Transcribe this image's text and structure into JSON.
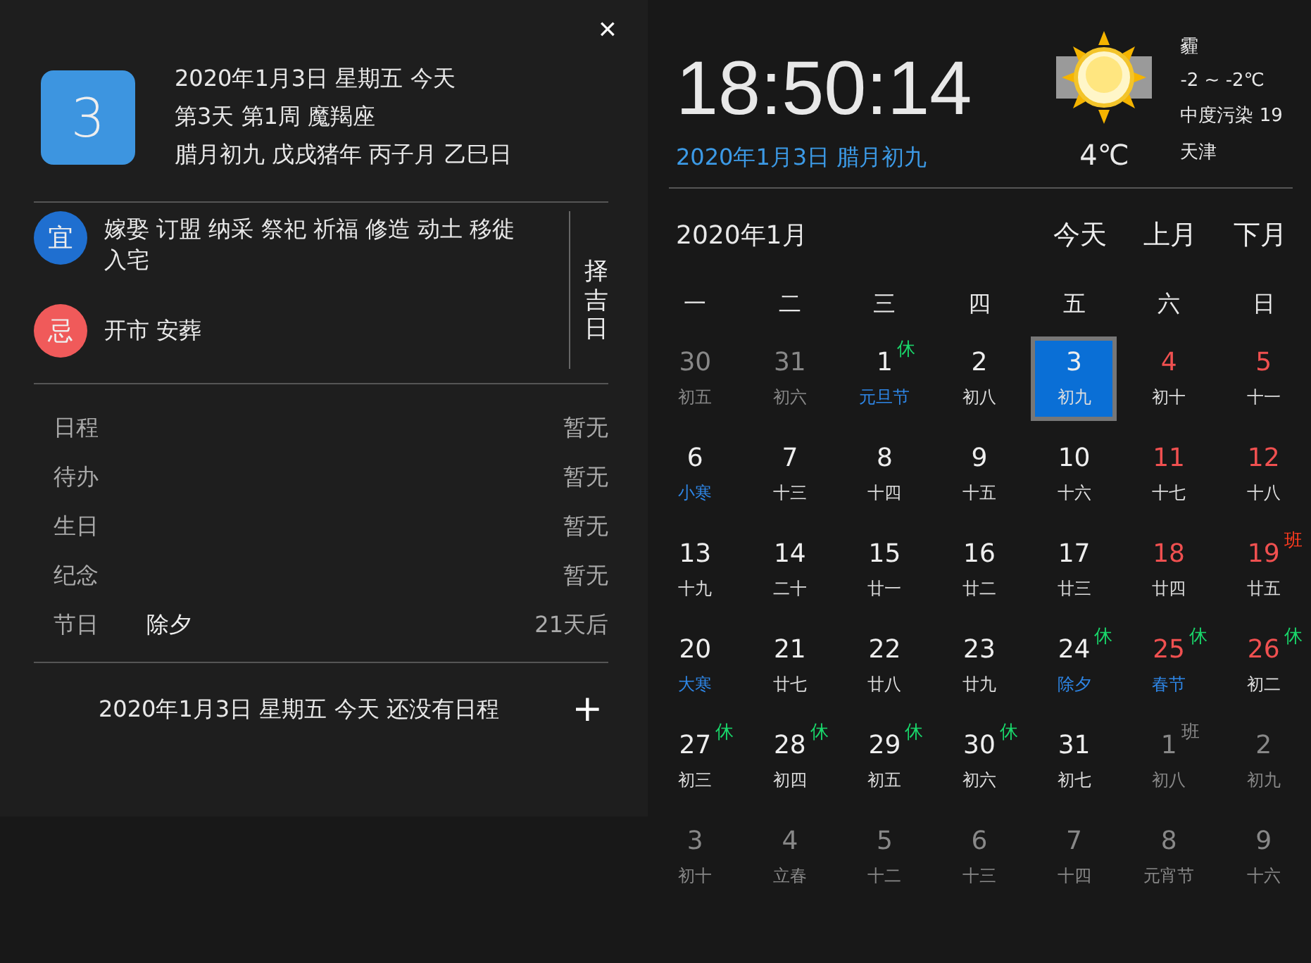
{
  "info": {
    "day": "3",
    "lines": [
      "2020年1月3日 星期五 今天",
      "第3天 第1周 魔羯座",
      "腊月初九 戊戌猪年 丙子月 乙巳日"
    ]
  },
  "close": "×",
  "almanac": [
    {
      "kind": "good",
      "mark": "宜",
      "text": "嫁娶 订盟 纳采 祭祀 祈福 修造 动土 移徙入宅"
    },
    {
      "kind": "bad",
      "mark": "忌",
      "text": "开市 安葬"
    }
  ],
  "pick_day": "择吉日",
  "agenda": [
    {
      "label": "日程",
      "value": "暂无"
    },
    {
      "label": "待办",
      "value": "暂无"
    },
    {
      "label": "生日",
      "value": "暂无"
    },
    {
      "label": "纪念",
      "value": "暂无"
    },
    {
      "label": "节日",
      "detail": "除夕",
      "value": "21天后"
    }
  ],
  "footer": {
    "text": "2020年1月3日 星期五 今天 还没有日程",
    "add": "+"
  },
  "clock": {
    "time": "18:50:14",
    "date": "2020年1月3日 腊月初九"
  },
  "weather": {
    "temp": "4℃",
    "lines": [
      "霾",
      "-2 ~ -2℃",
      "中度污染 19",
      "天津"
    ]
  },
  "calendar": {
    "month": "2020年1月",
    "nav": [
      "今天",
      "上月",
      "下月"
    ],
    "weekdays": [
      "一",
      "二",
      "三",
      "四",
      "五",
      "六",
      "日"
    ],
    "days": [
      {
        "day": "30",
        "lunar": "初五",
        "other_month": true,
        "weekend": false,
        "festival": false,
        "selected": false
      },
      {
        "day": "31",
        "lunar": "初六",
        "other_month": true,
        "weekend": false,
        "festival": false,
        "selected": false
      },
      {
        "day": "1",
        "lunar": "元旦节",
        "other_month": false,
        "weekend": false,
        "festival": true,
        "selected": false,
        "badge": {
          "text": "休",
          "kind": "rest"
        }
      },
      {
        "day": "2",
        "lunar": "初八",
        "other_month": false,
        "weekend": false,
        "festival": false,
        "selected": false
      },
      {
        "day": "3",
        "lunar": "初九",
        "other_month": false,
        "weekend": false,
        "festival": false,
        "selected": true
      },
      {
        "day": "4",
        "lunar": "初十",
        "other_month": false,
        "weekend": true,
        "festival": false,
        "selected": false
      },
      {
        "day": "5",
        "lunar": "十一",
        "other_month": false,
        "weekend": true,
        "festival": false,
        "selected": false
      },
      {
        "day": "6",
        "lunar": "小寒",
        "other_month": false,
        "weekend": false,
        "festival": true,
        "selected": false
      },
      {
        "day": "7",
        "lunar": "十三",
        "other_month": false,
        "weekend": false,
        "festival": false,
        "selected": false
      },
      {
        "day": "8",
        "lunar": "十四",
        "other_month": false,
        "weekend": false,
        "festival": false,
        "selected": false
      },
      {
        "day": "9",
        "lunar": "十五",
        "other_month": false,
        "weekend": false,
        "festival": false,
        "selected": false
      },
      {
        "day": "10",
        "lunar": "十六",
        "other_month": false,
        "weekend": false,
        "festival": false,
        "selected": false
      },
      {
        "day": "11",
        "lunar": "十七",
        "other_month": false,
        "weekend": true,
        "festival": false,
        "selected": false
      },
      {
        "day": "12",
        "lunar": "十八",
        "other_month": false,
        "weekend": true,
        "festival": false,
        "selected": false
      },
      {
        "day": "13",
        "lunar": "十九",
        "other_month": false,
        "weekend": false,
        "festival": false,
        "selected": false
      },
      {
        "day": "14",
        "lunar": "二十",
        "other_month": false,
        "weekend": false,
        "festival": false,
        "selected": false
      },
      {
        "day": "15",
        "lunar": "廿一",
        "other_month": false,
        "weekend": false,
        "festival": false,
        "selected": false
      },
      {
        "day": "16",
        "lunar": "廿二",
        "other_month": false,
        "weekend": false,
        "festival": false,
        "selected": false
      },
      {
        "day": "17",
        "lunar": "廿三",
        "other_month": false,
        "weekend": false,
        "festival": false,
        "selected": false
      },
      {
        "day": "18",
        "lunar": "廿四",
        "other_month": false,
        "weekend": true,
        "festival": false,
        "selected": false
      },
      {
        "day": "19",
        "lunar": "廿五",
        "other_month": false,
        "weekend": true,
        "festival": false,
        "selected": false,
        "badge": {
          "text": "班",
          "kind": "work"
        }
      },
      {
        "day": "20",
        "lunar": "大寒",
        "other_month": false,
        "weekend": false,
        "festival": true,
        "selected": false
      },
      {
        "day": "21",
        "lunar": "廿七",
        "other_month": false,
        "weekend": false,
        "festival": false,
        "selected": false
      },
      {
        "day": "22",
        "lunar": "廿八",
        "other_month": false,
        "weekend": false,
        "festival": false,
        "selected": false
      },
      {
        "day": "23",
        "lunar": "廿九",
        "other_month": false,
        "weekend": false,
        "festival": false,
        "selected": false
      },
      {
        "day": "24",
        "lunar": "除夕",
        "other_month": false,
        "weekend": false,
        "festival": true,
        "selected": false,
        "badge": {
          "text": "休",
          "kind": "rest"
        }
      },
      {
        "day": "25",
        "lunar": "春节",
        "other_month": false,
        "weekend": true,
        "festival": true,
        "selected": false,
        "badge": {
          "text": "休",
          "kind": "rest"
        }
      },
      {
        "day": "26",
        "lunar": "初二",
        "other_month": false,
        "weekend": true,
        "festival": false,
        "selected": false,
        "badge": {
          "text": "休",
          "kind": "rest"
        }
      },
      {
        "day": "27",
        "lunar": "初三",
        "other_month": false,
        "weekend": false,
        "festival": false,
        "selected": false,
        "badge": {
          "text": "休",
          "kind": "rest"
        }
      },
      {
        "day": "28",
        "lunar": "初四",
        "other_month": false,
        "weekend": false,
        "festival": false,
        "selected": false,
        "badge": {
          "text": "休",
          "kind": "rest"
        }
      },
      {
        "day": "29",
        "lunar": "初五",
        "other_month": false,
        "weekend": false,
        "festival": false,
        "selected": false,
        "badge": {
          "text": "休",
          "kind": "rest"
        }
      },
      {
        "day": "30",
        "lunar": "初六",
        "other_month": false,
        "weekend": false,
        "festival": false,
        "selected": false,
        "badge": {
          "text": "休",
          "kind": "rest"
        }
      },
      {
        "day": "31",
        "lunar": "初七",
        "other_month": false,
        "weekend": false,
        "festival": false,
        "selected": false
      },
      {
        "day": "1",
        "lunar": "初八",
        "other_month": true,
        "weekend": false,
        "festival": false,
        "selected": false,
        "badge": {
          "text": "班",
          "kind": "work"
        }
      },
      {
        "day": "2",
        "lunar": "初九",
        "other_month": true,
        "weekend": false,
        "festival": false,
        "selected": false
      },
      {
        "day": "3",
        "lunar": "初十",
        "other_month": true,
        "weekend": false,
        "festival": false,
        "selected": false
      },
      {
        "day": "4",
        "lunar": "立春",
        "other_month": true,
        "weekend": false,
        "festival": false,
        "selected": false
      },
      {
        "day": "5",
        "lunar": "十二",
        "other_month": true,
        "weekend": false,
        "festival": false,
        "selected": false
      },
      {
        "day": "6",
        "lunar": "十三",
        "other_month": true,
        "weekend": false,
        "festival": false,
        "selected": false
      },
      {
        "day": "7",
        "lunar": "十四",
        "other_month": true,
        "weekend": false,
        "festival": false,
        "selected": false
      },
      {
        "day": "8",
        "lunar": "元宵节",
        "other_month": true,
        "weekend": false,
        "festival": false,
        "selected": false
      },
      {
        "day": "9",
        "lunar": "十六",
        "other_month": true,
        "weekend": false,
        "festival": false,
        "selected": false
      }
    ]
  }
}
